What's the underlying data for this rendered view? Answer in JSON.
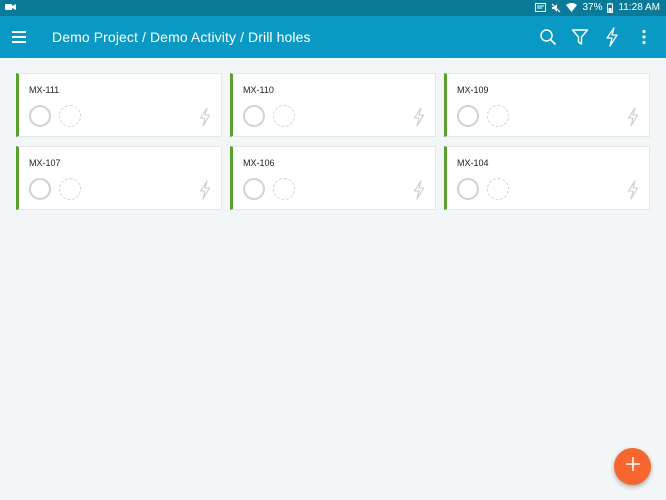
{
  "status_bar": {
    "battery": "37%",
    "time": "11:28 AM",
    "icons": [
      "video-icon",
      "cast-icon",
      "mute-icon",
      "wifi-icon",
      "battery-icon"
    ]
  },
  "app_bar": {
    "title": "Demo Project / Demo Activity / Drill holes",
    "icons": [
      "menu-icon",
      "search-icon",
      "filter-icon",
      "lightning-icon",
      "more-vert-icon"
    ]
  },
  "cards": [
    {
      "name": "MX-111"
    },
    {
      "name": "MX-110"
    },
    {
      "name": "MX-109"
    },
    {
      "name": "MX-107"
    },
    {
      "name": "MX-106"
    },
    {
      "name": "MX-104"
    }
  ],
  "fab": {
    "icon": "plus-icon"
  },
  "colors": {
    "status_bar": "#0a7a98",
    "app_bar": "#0999c4",
    "card_accent": "#5aa02c",
    "fab": "#f7662f",
    "background": "#f2f6f7"
  }
}
